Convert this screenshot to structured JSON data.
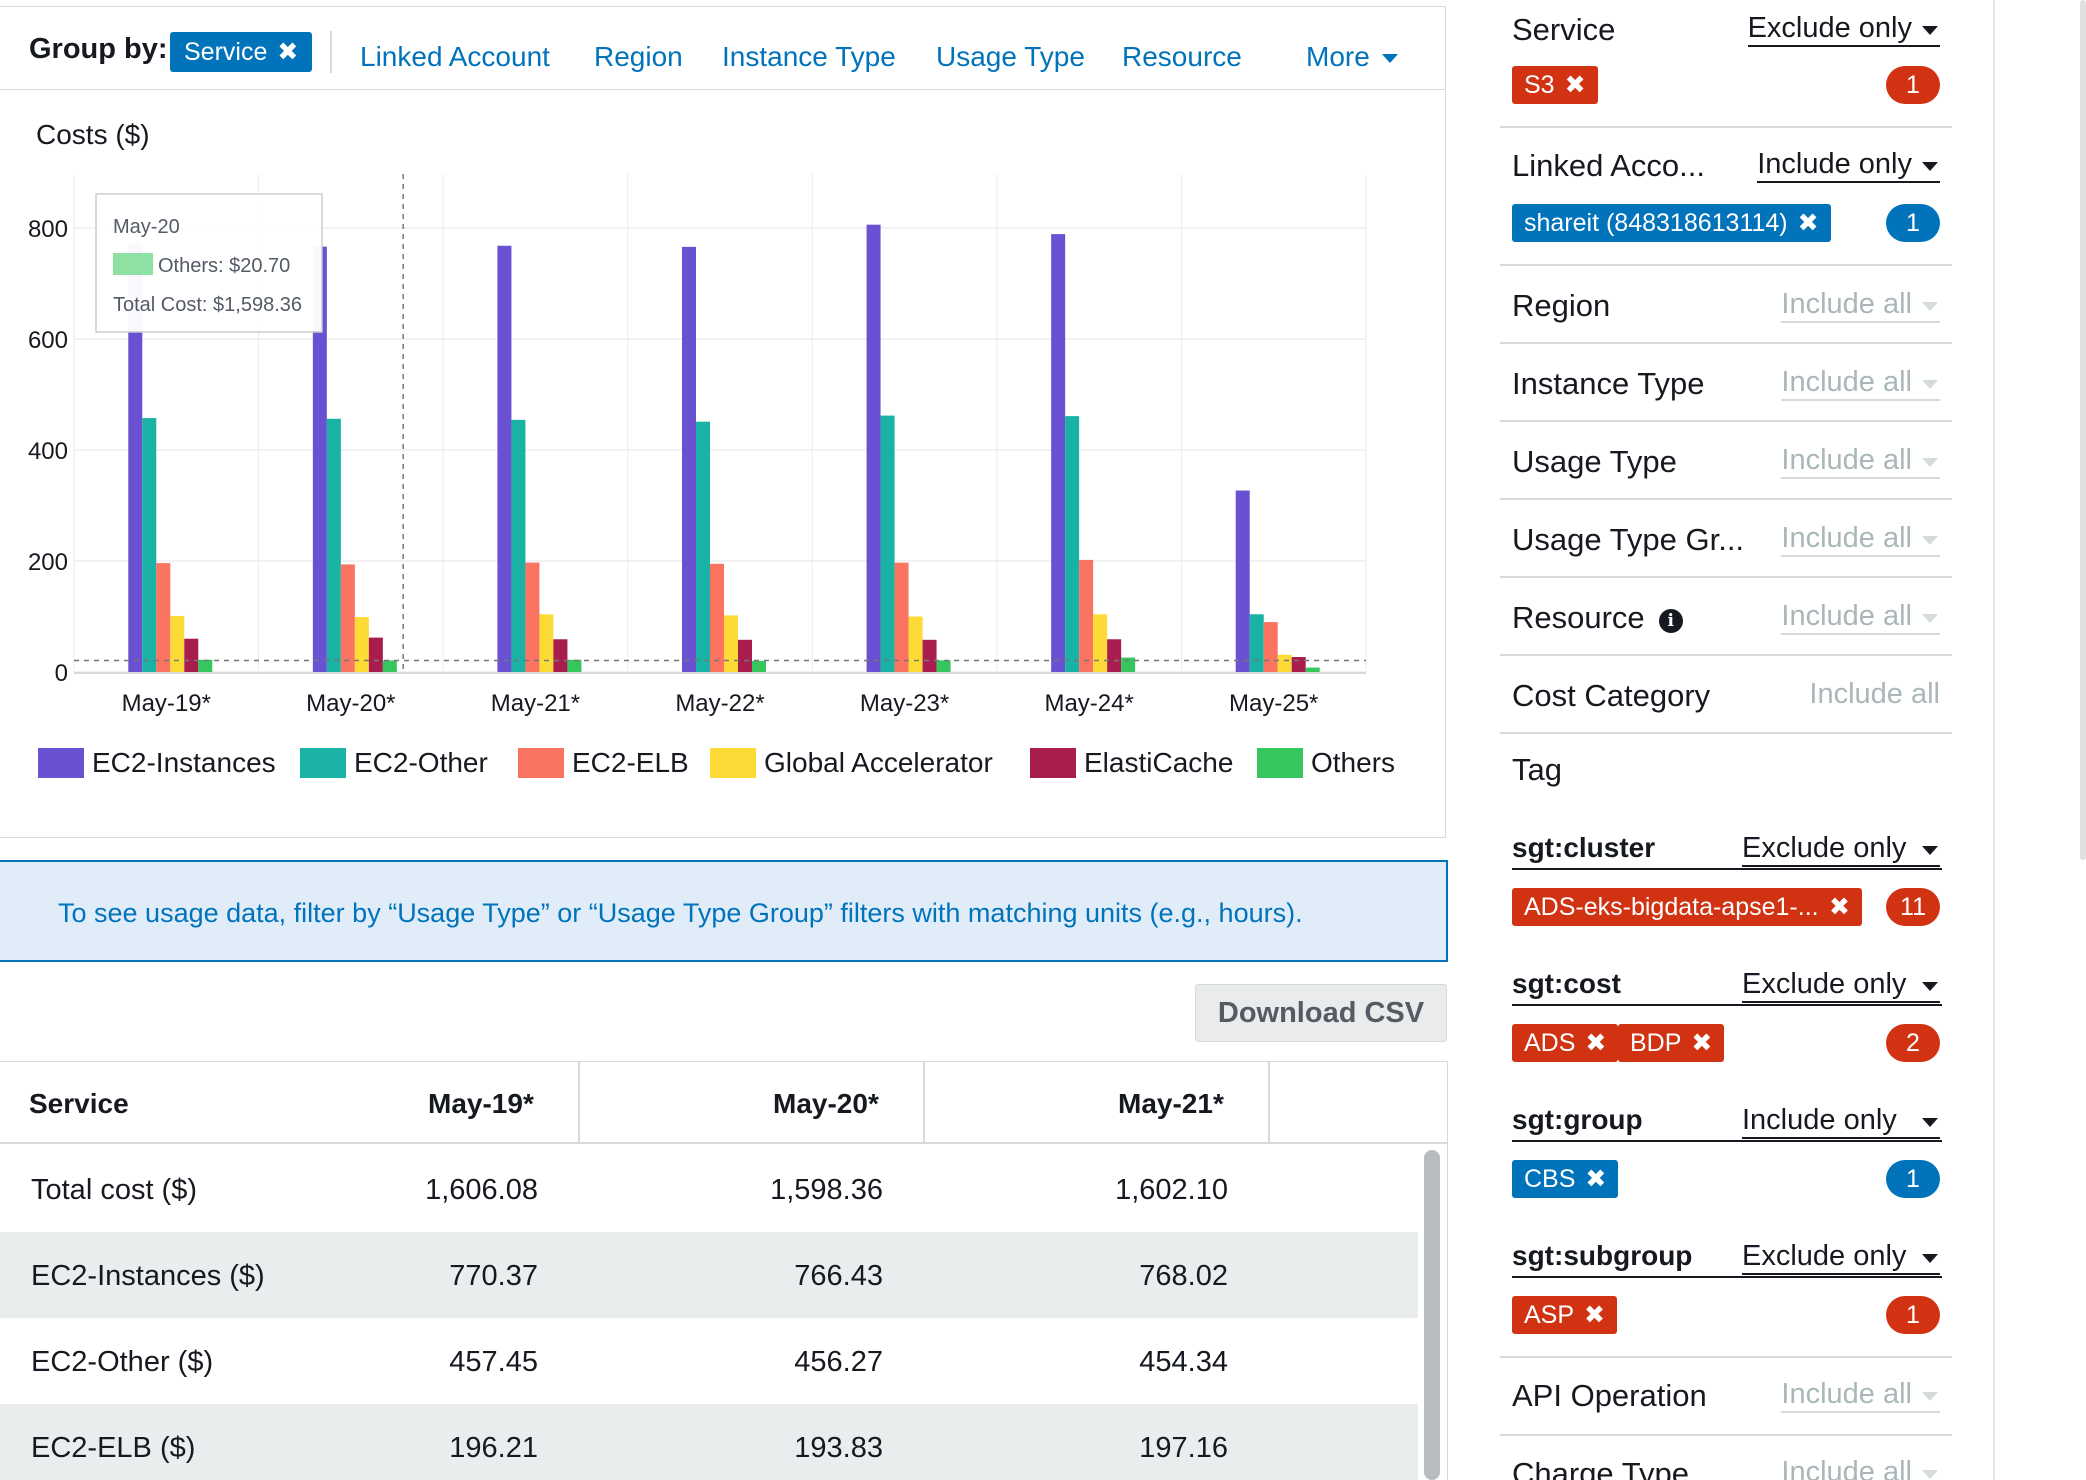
{
  "group_by": {
    "label": "Group by:",
    "active_chip": "Service",
    "links": [
      "Linked Account",
      "Region",
      "Instance Type",
      "Usage Type",
      "Resource"
    ],
    "more": "More"
  },
  "chart_data": {
    "type": "bar",
    "title": "Costs ($)",
    "categories": [
      "May-19*",
      "May-20*",
      "May-21*",
      "May-22*",
      "May-23*",
      "May-24*",
      "May-25*"
    ],
    "ylim": [
      0,
      800
    ],
    "yticks": [
      0,
      200,
      400,
      600,
      800
    ],
    "grid": true,
    "legend_position": "bottom",
    "series": [
      {
        "name": "EC2-Instances",
        "color": "#6a51d1",
        "values": [
          770.37,
          766.43,
          768.02,
          766,
          806,
          789,
          327
        ]
      },
      {
        "name": "EC2-Other",
        "color": "#19b2a4",
        "values": [
          457.45,
          456.27,
          454.34,
          451,
          462,
          461,
          104
        ]
      },
      {
        "name": "EC2-ELB",
        "color": "#fb7462",
        "values": [
          196.21,
          193.83,
          197.16,
          195,
          197,
          202,
          90
        ]
      },
      {
        "name": "Global Accelerator",
        "color": "#fddb37",
        "values": [
          101,
          99,
          104,
          102,
          100,
          104,
          31
        ]
      },
      {
        "name": "ElastiCache",
        "color": "#a91d4e",
        "values": [
          60,
          62,
          59,
          58,
          58,
          59,
          27
        ]
      },
      {
        "name": "Others",
        "color": "#36c65e",
        "values": [
          22,
          20.7,
          22,
          20,
          21,
          26,
          8
        ]
      }
    ],
    "tooltip": {
      "date": "May-20",
      "series_label": "Others: $20.70",
      "swatch_color": "#8fe0a3",
      "total": "Total Cost: $1,598.36"
    }
  },
  "banner": {
    "text": "To see usage data, filter by “Usage Type” or “Usage Type Group” filters with matching units (e.g., hours)."
  },
  "download_csv": "Download CSV",
  "table": {
    "columns": [
      "Service",
      "May-19*",
      "May-20*",
      "May-21*"
    ],
    "rows": [
      [
        "Total cost ($)",
        "1,606.08",
        "1,598.36",
        "1,602.10"
      ],
      [
        "EC2-Instances ($)",
        "770.37",
        "766.43",
        "768.02"
      ],
      [
        "EC2-Other ($)",
        "457.45",
        "456.27",
        "454.34"
      ],
      [
        "EC2-ELB ($)",
        "196.21",
        "193.83",
        "197.16"
      ]
    ]
  },
  "filters": {
    "service": {
      "label": "Service",
      "mode": "Exclude only",
      "tags": [
        "S3"
      ],
      "count": "1"
    },
    "linked_account": {
      "label": "Linked Acco...",
      "mode": "Include only",
      "tags": [
        "shareit (848318613114)"
      ],
      "count": "1"
    },
    "region": {
      "label": "Region",
      "mode": "Include all"
    },
    "instance_type": {
      "label": "Instance Type",
      "mode": "Include all"
    },
    "usage_type": {
      "label": "Usage Type",
      "mode": "Include all"
    },
    "usage_type_group": {
      "label": "Usage Type Gr...",
      "mode": "Include all"
    },
    "resource": {
      "label": "Resource",
      "mode": "Include all"
    },
    "cost_category": {
      "label": "Cost Category",
      "mode": "Include all"
    },
    "tag": {
      "label": "Tag"
    },
    "sgt_cluster": {
      "label": "sgt:cluster",
      "mode": "Exclude only",
      "tags": [
        "ADS-eks-bigdata-apse1-..."
      ],
      "count": "11"
    },
    "sgt_cost": {
      "label": "sgt:cost",
      "mode": "Exclude only",
      "tags": [
        "ADS",
        "BDP"
      ],
      "count": "2"
    },
    "sgt_group": {
      "label": "sgt:group",
      "mode": "Include only",
      "tags": [
        "CBS"
      ],
      "count": "1"
    },
    "sgt_subgroup": {
      "label": "sgt:subgroup",
      "mode": "Exclude only",
      "tags": [
        "ASP"
      ],
      "count": "1"
    },
    "api_operation": {
      "label": "API Operation",
      "mode": "Include all"
    },
    "charge_type": {
      "label": "Charge Type",
      "mode": "Include all"
    }
  }
}
